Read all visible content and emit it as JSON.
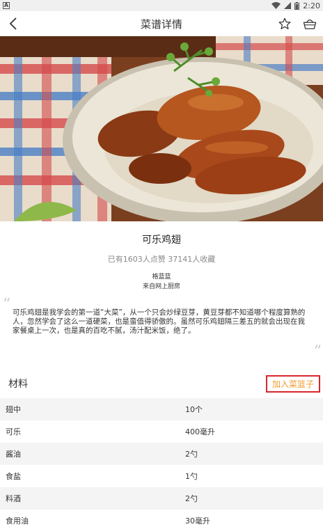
{
  "status_bar": {
    "app_icon_letter": "A",
    "time": "2:20"
  },
  "app_bar": {
    "title": "菜谱详情"
  },
  "recipe": {
    "name": "可乐鸡翅",
    "stats": "已有1603人点赞   37141人收藏",
    "author": "格蓝蓝",
    "source": "来自网上厨房",
    "description": "可乐鸡翅是我学会的第一道“大菜”，从一个只会炒绿豆芽，黄豆芽都不知道哪个程度算熟的人，忽然学会了这么一道硬菜，也是蛮值得骄傲的。虽然可乐鸡翅隔三差五的就会出现在我家餐桌上一次，也是真的百吃不腻，汤汁配米饭，绝了。"
  },
  "ingredients_section": {
    "title": "材料",
    "basket_button": "加入菜篮子",
    "items": [
      {
        "name": "翅中",
        "qty": "10个"
      },
      {
        "name": "可乐",
        "qty": "400毫升"
      },
      {
        "name": "酱油",
        "qty": "2勺"
      },
      {
        "name": "食盐",
        "qty": "1勺"
      },
      {
        "name": "料酒",
        "qty": "2勺"
      },
      {
        "name": "食用油",
        "qty": "30毫升"
      }
    ]
  },
  "colors": {
    "basket_border": "#d8262b",
    "basket_text": "#f39a2d"
  }
}
